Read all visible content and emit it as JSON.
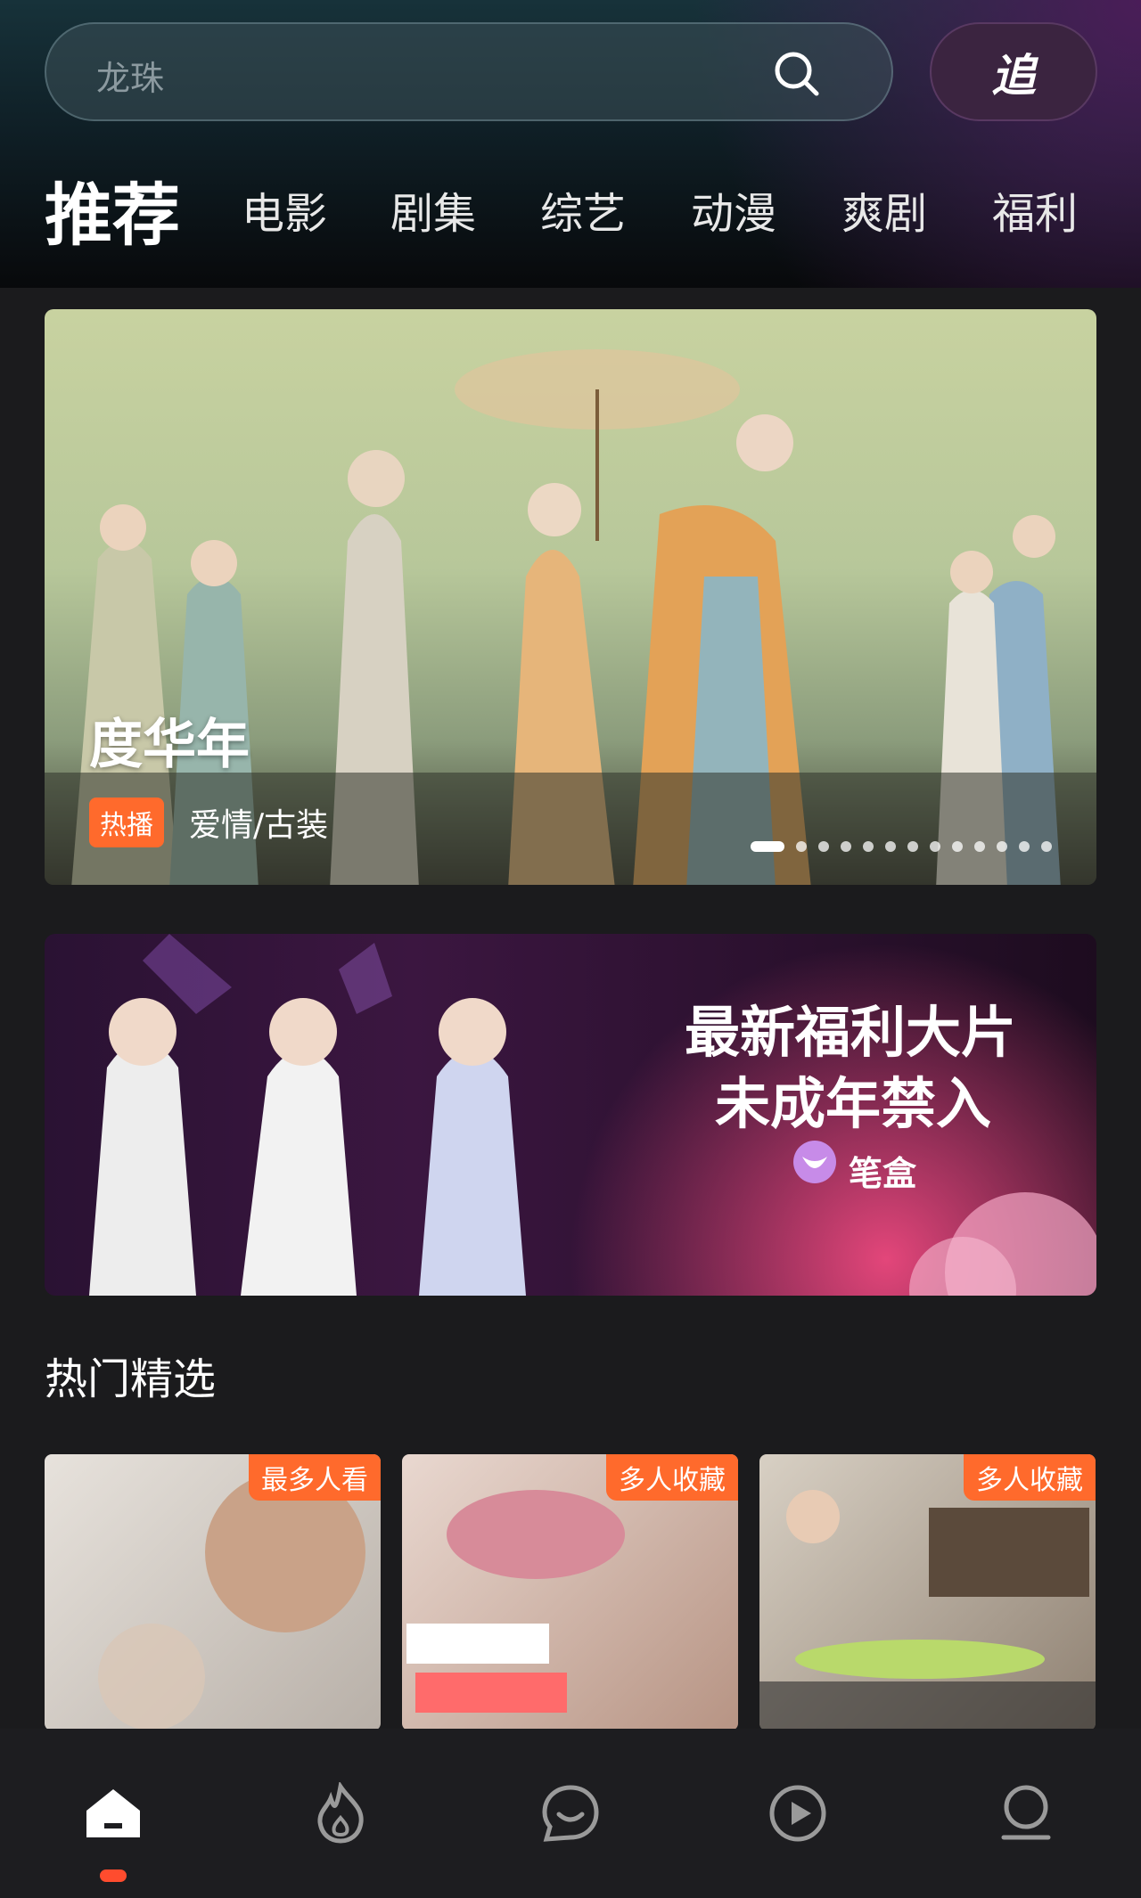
{
  "search": {
    "placeholder": "龙珠",
    "icon": "search-icon"
  },
  "track_button": {
    "label": "追"
  },
  "nav_tabs": [
    {
      "label": "推荐",
      "active": true
    },
    {
      "label": "电影"
    },
    {
      "label": "剧集"
    },
    {
      "label": "综艺"
    },
    {
      "label": "动漫"
    },
    {
      "label": "爽剧"
    },
    {
      "label": "福利"
    }
  ],
  "banner": {
    "title": "度华年",
    "badge": "热播",
    "genre": "爱情/古装",
    "carousel_active_index": 0,
    "carousel_count": 13
  },
  "promo": {
    "line1": "最新福利大片",
    "line2": "未成年禁入",
    "brand": "笔盒"
  },
  "section": {
    "title": "热门精选"
  },
  "cards": [
    {
      "tag": "最多人看"
    },
    {
      "tag": "多人收藏"
    },
    {
      "tag": "多人收藏"
    }
  ],
  "tabbar": {
    "items": [
      "home-icon",
      "fire-icon",
      "chat-icon",
      "play-icon",
      "profile-icon"
    ],
    "active_index": 0
  },
  "colors": {
    "accent": "#ff6a2c",
    "indicator": "#ff4c2e",
    "background": "#1b1b1d"
  }
}
